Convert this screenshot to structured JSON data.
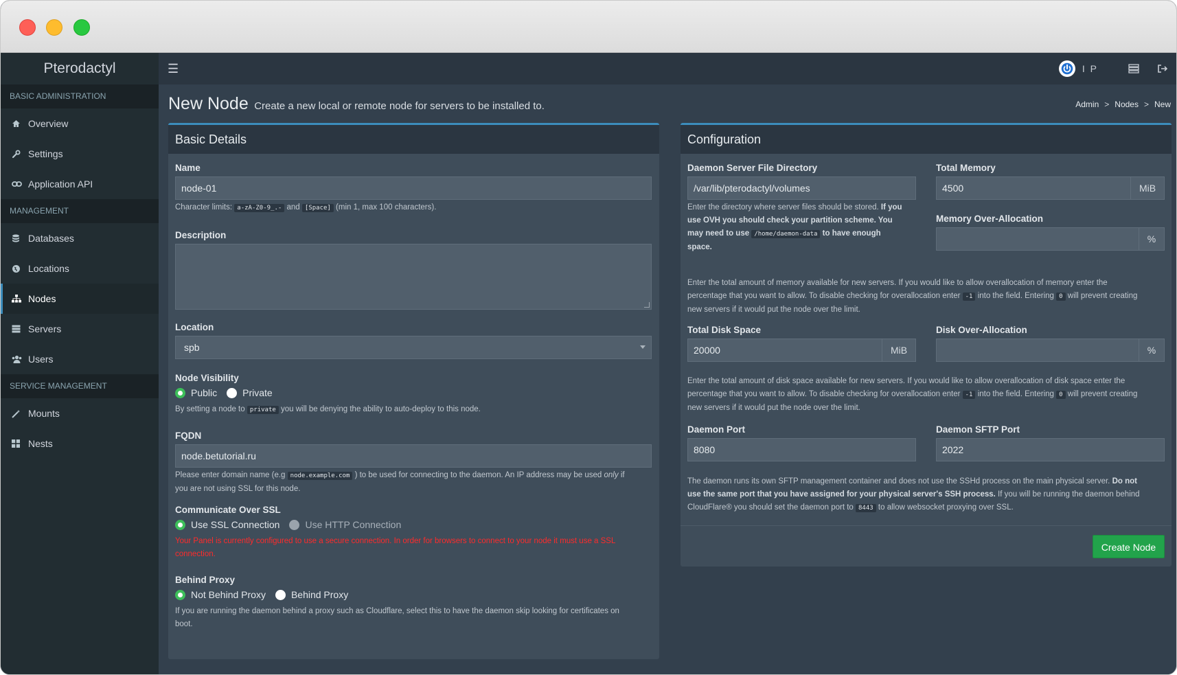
{
  "app": {
    "brand": "Pterodactyl"
  },
  "topnav": {
    "user_initials": "I P"
  },
  "sidebar": {
    "sections": [
      {
        "header": "BASIC ADMINISTRATION",
        "items": [
          {
            "label": "Overview",
            "icon": "home-icon"
          },
          {
            "label": "Settings",
            "icon": "wrench-icon"
          },
          {
            "label": "Application API",
            "icon": "link-icon"
          }
        ]
      },
      {
        "header": "MANAGEMENT",
        "items": [
          {
            "label": "Databases",
            "icon": "database-icon"
          },
          {
            "label": "Locations",
            "icon": "globe-icon"
          },
          {
            "label": "Nodes",
            "icon": "sitemap-icon"
          },
          {
            "label": "Servers",
            "icon": "server-icon"
          },
          {
            "label": "Users",
            "icon": "users-icon"
          }
        ]
      },
      {
        "header": "SERVICE MANAGEMENT",
        "items": [
          {
            "label": "Mounts",
            "icon": "magic-icon"
          },
          {
            "label": "Nests",
            "icon": "th-large-icon"
          }
        ]
      }
    ],
    "active": "Nodes"
  },
  "page": {
    "title": "New Node",
    "subtitle": "Create a new local or remote node for servers to be installed to.",
    "breadcrumb": [
      "Admin",
      ">",
      "Nodes",
      ">",
      "New"
    ]
  },
  "basic": {
    "header": "Basic Details",
    "name_label": "Name",
    "name_value": "node-01",
    "name_help_1": "Character limits:",
    "name_help_code1": "a-zA-Z0-9_.-",
    "name_help_2": "and",
    "name_help_code2": "[Space]",
    "name_help_3": "(min 1, max 100 characters).",
    "description_label": "Description",
    "description_value": "",
    "location_label": "Location",
    "location_value": "spb",
    "visibility_label": "Node Visibility",
    "visibility_public": "Public",
    "visibility_private": "Private",
    "visibility_help_1": "By setting a node to",
    "visibility_help_code": "private",
    "visibility_help_2": "you will be denying the ability to auto-deploy to this node.",
    "fqdn_label": "FQDN",
    "fqdn_value": "node.betutorial.ru",
    "fqdn_help_1": "Please enter domain name (e.g",
    "fqdn_help_code": "node.example.com",
    "fqdn_help_2": ") to be used for connecting to the daemon. An IP address may be used",
    "fqdn_help_em": "only",
    "fqdn_help_3": "if",
    "fqdn_help_4": "you are not using SSL for this node.",
    "ssl_label": "Communicate Over SSL",
    "ssl_option_ssl": "Use SSL Connection",
    "ssl_option_http": "Use HTTP Connection",
    "ssl_warning_1": "Your Panel is currently configured to use a secure connection. In order for browsers to connect to your node it must use a SSL",
    "ssl_warning_2": "connection.",
    "proxy_label": "Behind Proxy",
    "proxy_option_no": "Not Behind Proxy",
    "proxy_option_yes": "Behind Proxy",
    "proxy_help_1": "If you are running the daemon behind a proxy such as Cloudflare, select this to have the daemon skip looking for certificates on",
    "proxy_help_2": "boot."
  },
  "config": {
    "header": "Configuration",
    "dir_label": "Daemon Server File Directory",
    "dir_value": "/var/lib/pterodactyl/volumes",
    "dir_help_1": "Enter the directory where server files should be stored.",
    "dir_help_b1": "If you",
    "dir_help_b2": "use OVH you should check your partition scheme. You",
    "dir_help_b3": "may need to use",
    "dir_help_code": "/home/daemon-data",
    "dir_help_b4": "to have enough",
    "dir_help_b5": "space.",
    "mem_label": "Total Memory",
    "mem_value": "4500",
    "mem_unit": "MiB",
    "mem_over_label": "Memory Over-Allocation",
    "mem_over_value": "",
    "mem_over_unit": "%",
    "mem_help_1": "Enter the total amount of memory available for new servers. If you would like to allow overallocation of memory enter the",
    "mem_help_2a": "percentage that you want to allow. To disable checking for overallocation enter",
    "mem_help_code1": "-1",
    "mem_help_2b": "into the field. Entering",
    "mem_help_code2": "0",
    "mem_help_2c": "will prevent creating",
    "mem_help_3": "new servers if it would put the node over the limit.",
    "disk_label": "Total Disk Space",
    "disk_value": "20000",
    "disk_unit": "MiB",
    "disk_over_label": "Disk Over-Allocation",
    "disk_over_value": "",
    "disk_over_unit": "%",
    "disk_help_1": "Enter the total amount of disk space available for new servers. If you would like to allow overallocation of disk space enter the",
    "disk_help_2a": "percentage that you want to allow. To disable checking for overallocation enter",
    "disk_help_code1": "-1",
    "disk_help_2b": "into the field. Entering",
    "disk_help_code2": "0",
    "disk_help_2c": "will prevent creating",
    "disk_help_3": "new servers if it would put the node over the limit.",
    "port_label": "Daemon Port",
    "port_value": "8080",
    "sftp_label": "Daemon SFTP Port",
    "sftp_value": "2022",
    "port_help_1": "The daemon runs its own SFTP management container and does not use the SSHd process on the main physical server.",
    "port_help_b1": "Do not",
    "port_help_b2": "use the same port that you have assigned for your physical server's SSH process.",
    "port_help_2": "If you will be running the daemon behind",
    "port_help_3a": "CloudFlare® you should set the daemon port to",
    "port_help_code": "8443",
    "port_help_3b": "to allow websocket proxying over SSL.",
    "create_button": "Create Node"
  },
  "colors": {
    "accent": "#3c8dbc",
    "success": "#22a34b",
    "danger": "#ff2b2b"
  }
}
